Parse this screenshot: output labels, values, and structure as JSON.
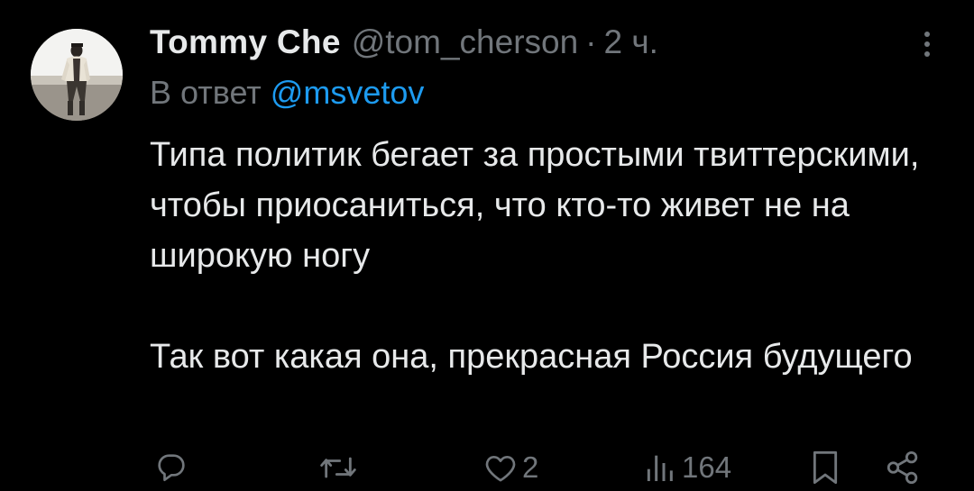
{
  "tweet": {
    "author_name": "Tommy Che",
    "author_handle": "@tom_cherson",
    "separator": "·",
    "time": "2 ч.",
    "reply_prefix": "В ответ",
    "reply_mention": "@msvetov",
    "body_paragraph_1": "Типа политик бегает за простыми твиттерскими, чтобы приосаниться, что кто-то живет не на широкую ногу",
    "body_paragraph_2": "Так вот какая она, прекрасная Россия будущего"
  },
  "actions": {
    "reply_icon": "reply-icon",
    "retweet_icon": "retweet-icon",
    "like_icon": "heart-icon",
    "like_count": "2",
    "views_icon": "views-icon",
    "views_count": "164",
    "bookmark_icon": "bookmark-icon",
    "share_icon": "share-icon"
  },
  "colors": {
    "background": "#000000",
    "text": "#e7e9ea",
    "secondary": "#71767b",
    "accent": "#1d9bf0"
  }
}
